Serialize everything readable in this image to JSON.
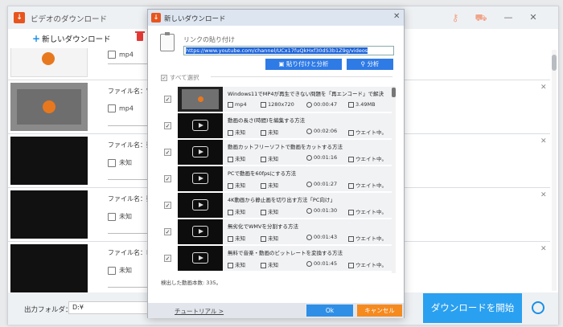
{
  "app": {
    "title": "ビデオのダウンロード",
    "new_download": "新しいダウンロード"
  },
  "list": {
    "rows": [
      {
        "name": "",
        "format": "mp4",
        "thumb": "light"
      },
      {
        "name": "ファイル名：Windo",
        "format": "mp4",
        "thumb": "gray"
      },
      {
        "name": "ファイル名：動画",
        "format": "未知",
        "thumb": "dark"
      },
      {
        "name": "ファイル名：動画",
        "format": "未知",
        "thumb": "dark"
      },
      {
        "name": "ファイル名：PC",
        "format": "未知",
        "thumb": "dark"
      }
    ]
  },
  "bottom": {
    "output_label": "出力フォルダ：",
    "output_path": "D:¥",
    "start_button": "ダウンロードを開始"
  },
  "dialog": {
    "title": "新しいダウンロード",
    "link_label": "リンクの貼り付け",
    "url": "https://www.youtube.com/channel/UCx17fuQkHxf30dS3b1Z9g/videos",
    "paste_analyze": "貼り付けと分析",
    "analyze": "分析",
    "select_all": "すべて選択",
    "videos": [
      {
        "title": "Windows11でMP4が再生できない問題を「再エンコード」で解決",
        "format": "mp4",
        "resolution": "1280x720",
        "duration": "00:00:47",
        "size": "3.49MB",
        "thumb": "gray"
      },
      {
        "title": "動画の長さ(時間)を編集する方法",
        "format": "未知",
        "resolution": "未知",
        "duration": "00:02:06",
        "size": "ウエイト中。",
        "thumb": "dark"
      },
      {
        "title": "動画カットフリーソフトで動画をカットする方法",
        "format": "未知",
        "resolution": "未知",
        "duration": "00:01:16",
        "size": "ウエイト中。",
        "thumb": "dark"
      },
      {
        "title": "PCで動画を60fpsにする方法",
        "format": "未知",
        "resolution": "未知",
        "duration": "00:01:27",
        "size": "ウエイト中。",
        "thumb": "dark"
      },
      {
        "title": "4K動画から静止画を切り出す方法「PC向け」",
        "format": "未知",
        "resolution": "未知",
        "duration": "00:01:30",
        "size": "ウエイト中。",
        "thumb": "dark"
      },
      {
        "title": "無劣化でWMVを分割する方法",
        "format": "未知",
        "resolution": "未知",
        "duration": "00:01:43",
        "size": "ウエイト中。",
        "thumb": "dark"
      },
      {
        "title": "無料で音楽・動画のビットレートを変換する方法",
        "format": "未知",
        "resolution": "未知",
        "duration": "00:01:45",
        "size": "ウエイト中。",
        "thumb": "dark"
      }
    ],
    "count_text": "検出した動画本数: 335。",
    "tutorial": "チュートリアル >",
    "ok": "Ok",
    "cancel": "キャンセル"
  }
}
